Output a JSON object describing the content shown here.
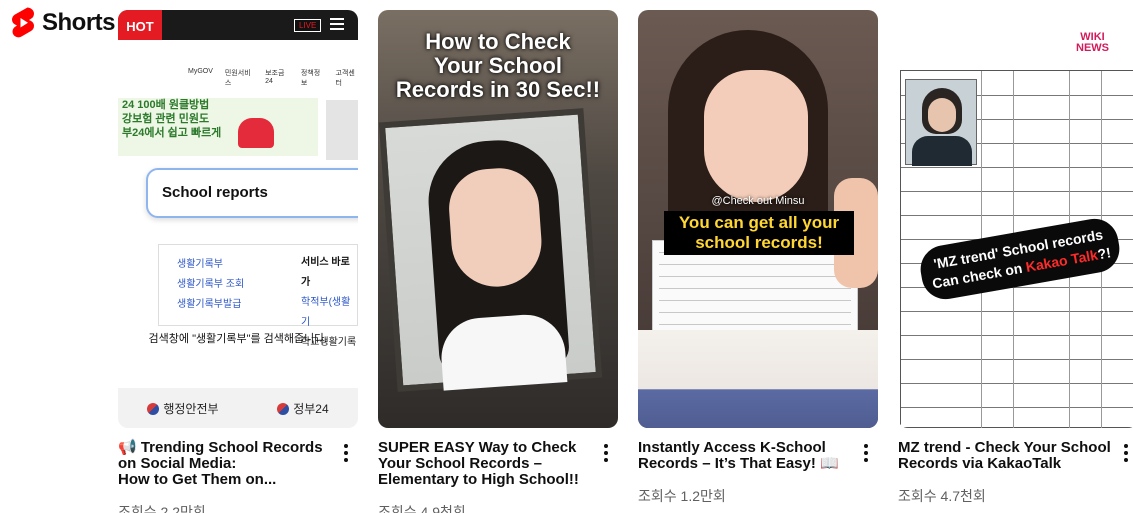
{
  "shelf": {
    "title": "Shorts",
    "brand_color": "#ff0000"
  },
  "cards": [
    {
      "title_line1": "📢 Trending School Records",
      "title_line2": "on Social Media:",
      "title_line3": "How to Get Them on...",
      "views": "조회수 2.2만회",
      "thumb": {
        "badge": "HOT",
        "live": "LIVE",
        "nav": [
          "MyGOV",
          "민원서비스",
          "보조금24",
          "정책정보",
          "고객센터"
        ],
        "banner_line1": "24 100배 원클방법",
        "banner_line2": "강보험 관련 민원도",
        "banner_line3": "부24에서 쉽고 빠르게",
        "search_text": "School reports",
        "results_col1": [
          "생활기록부",
          "생활기록부 조회",
          "생활기록부발급"
        ],
        "results_col2_head": "서비스 바로가",
        "results_col2": [
          "학적부(생활기",
          "학교생활기록"
        ],
        "note": "검색창에 \"생활기록부\"를 검색해줍니다.",
        "logo1": "행정안전부",
        "logo2": "정부24"
      }
    },
    {
      "title_line1": "SUPER EASY Way to Check",
      "title_line2": "Your School Records –",
      "title_line3": "Elementary to High School!!",
      "views": "조회수 4.9천회",
      "thumb": {
        "overlay_line1": "How to Check",
        "overlay_line2": "Your School",
        "overlay_line3": "Records in 30 Sec!!"
      }
    },
    {
      "title_line1": "Instantly Access K-School",
      "title_line2": "Records – It’s That Easy! 📖",
      "views": "조회수 1.2만회",
      "thumb": {
        "handle": "@Check out Minsu",
        "caption_line1": "You can get all your",
        "caption_line2": "school records!"
      }
    },
    {
      "title_line1": "MZ trend - Check Your School",
      "title_line2": "Records via KakaoTalk",
      "views": "조회수 4.7천회",
      "thumb": {
        "logo_line1": "WIKI",
        "logo_line2": "NEWS",
        "bubble_line1": "'MZ trend' School records",
        "bubble_pre": "Can check on ",
        "bubble_red": "Kakao Talk",
        "bubble_post": "?!"
      }
    }
  ],
  "icons": {
    "shorts_logo": "shorts-logo-icon",
    "more": "more-vert-icon"
  }
}
